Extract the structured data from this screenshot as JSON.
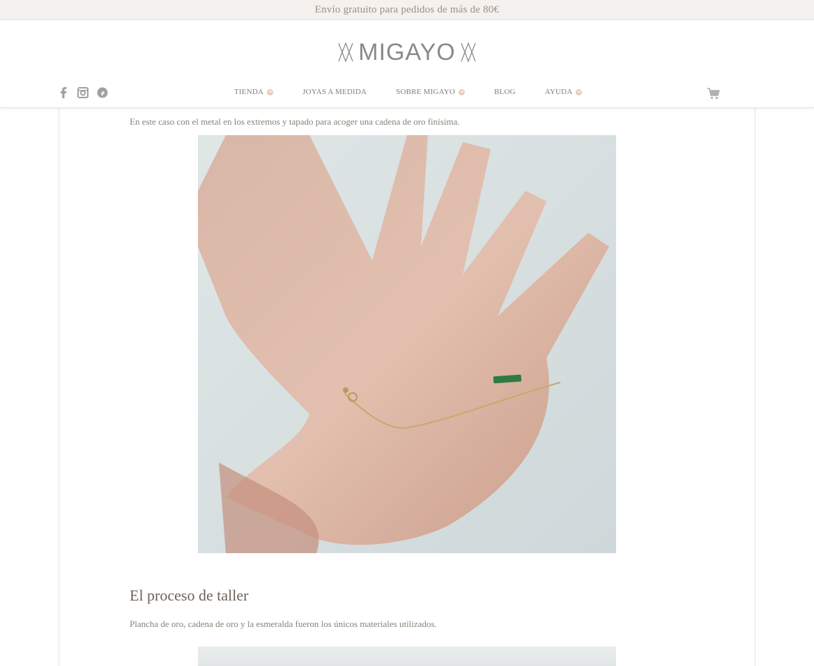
{
  "announcement": "Envío gratuito para pedidos de más de 80€",
  "brand": {
    "name": "MIGAYO"
  },
  "social": [
    {
      "name": "facebook-icon"
    },
    {
      "name": "instagram-icon"
    },
    {
      "name": "pinterest-icon"
    }
  ],
  "nav": {
    "items": [
      {
        "label": "TIENDA",
        "has_dropdown": true
      },
      {
        "label": "JOYAS A MEDIDA",
        "has_dropdown": false
      },
      {
        "label": "SOBRE MIGAYO",
        "has_dropdown": true
      },
      {
        "label": "BLOG",
        "has_dropdown": false
      },
      {
        "label": "AYUDA",
        "has_dropdown": true
      }
    ]
  },
  "cart_icon": "cart-icon",
  "article": {
    "intro_text": "En este caso con el metal en los extremos y tapado para acoger una cadena de oro finísima.",
    "section_title": "El proceso de taller",
    "section_text": "Plancha de oro, cadena de oro y la esmeralda fueron los únicos materiales utilizados."
  },
  "colors": {
    "accent_dot": "#ecc9bd",
    "topbar_bg": "#f4f1ee",
    "text": "#8a8178"
  }
}
